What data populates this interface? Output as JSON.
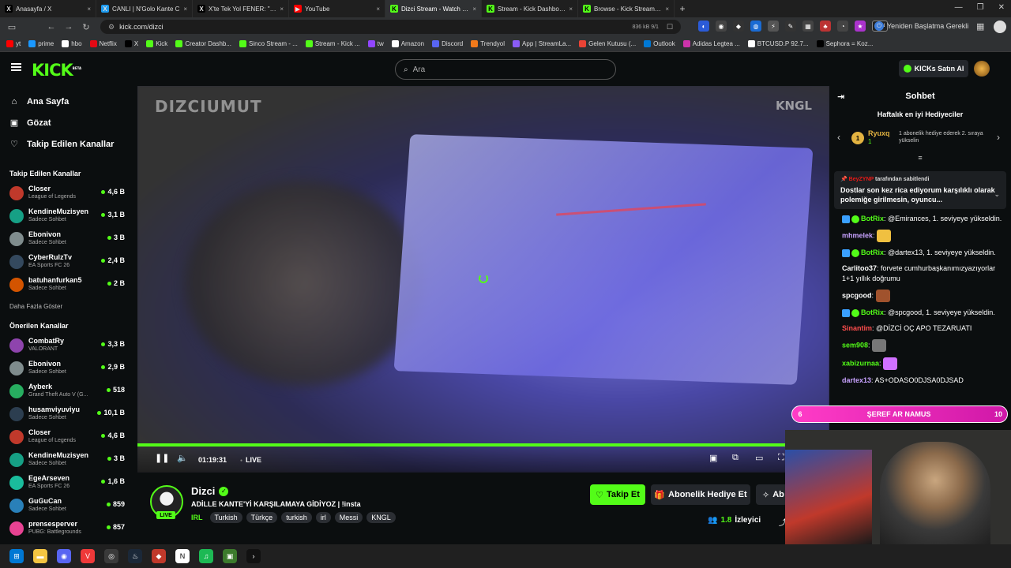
{
  "tabs": [
    {
      "label": "Anasayfa / X",
      "color": "#000000",
      "glyph": "X"
    },
    {
      "label": "CANLI | N'Golo Kante C",
      "color": "#1d9bf0",
      "glyph": "X"
    },
    {
      "label": "X'te Tek Yol FENER: \"Binlerce",
      "color": "#000000",
      "glyph": "X"
    },
    {
      "label": "YouTube",
      "color": "#ff0000",
      "glyph": "▶"
    },
    {
      "label": "Dizci Stream - Watch Live o",
      "color": "#53fc18",
      "glyph": "K"
    },
    {
      "label": "Stream - Kick Dashboard",
      "color": "#53fc18",
      "glyph": "K"
    },
    {
      "label": "Browse - Kick Streaming",
      "color": "#53fc18",
      "glyph": "K"
    }
  ],
  "browser": {
    "url": "kick.com/dizci",
    "meta": "836 kB  9/1",
    "restart_label": "Yeniden Başlatma Gerekli",
    "vpn": "VPN"
  },
  "bookmarks": [
    {
      "label": "yt",
      "color": "#ff0000"
    },
    {
      "label": "prime",
      "color": "#1a98ff"
    },
    {
      "label": "hbo",
      "color": "#ffffff"
    },
    {
      "label": "Netflix",
      "color": "#e50914"
    },
    {
      "label": "X",
      "color": "#000000"
    },
    {
      "label": "Kick",
      "color": "#53fc18"
    },
    {
      "label": "Creator Dashb...",
      "color": "#53fc18"
    },
    {
      "label": "Sinco Stream - ...",
      "color": "#53fc18"
    },
    {
      "label": "Stream - Kick ...",
      "color": "#53fc18"
    },
    {
      "label": "tw",
      "color": "#9146ff"
    },
    {
      "label": "Amazon",
      "color": "#ffffff"
    },
    {
      "label": "Discord",
      "color": "#5865f2"
    },
    {
      "label": "Trendyol",
      "color": "#f27a1a"
    },
    {
      "label": "App | StreamLa...",
      "color": "#8a5cf6"
    },
    {
      "label": "Gelen Kutusu (...",
      "color": "#ea4335"
    },
    {
      "label": "Outlook",
      "color": "#0078d4"
    },
    {
      "label": "Adidas Legtea ...",
      "color": "#cc33aa"
    },
    {
      "label": "BTCUSD.P 92.7...",
      "color": "#ffffff"
    },
    {
      "label": "Sephora = Koz...",
      "color": "#000000"
    }
  ],
  "header": {
    "logo": "KICK",
    "logo_beta": "BETA",
    "search_placeholder": "Ara",
    "buy_kicks": "KICKs Satın Al"
  },
  "sidebar": {
    "nav": [
      {
        "label": "Ana Sayfa",
        "icon": "home-icon"
      },
      {
        "label": "Gözat",
        "icon": "browse-icon"
      },
      {
        "label": "Takip Edilen Kanallar",
        "icon": "heart-icon"
      }
    ],
    "following_title": "Takip Edilen Kanallar",
    "following": [
      {
        "name": "Closer",
        "game": "League of Legends",
        "viewers": "4,6 B",
        "color": "#c0392b"
      },
      {
        "name": "KendineMuzisyen",
        "game": "Sadece Sohbet",
        "viewers": "3,1 B",
        "color": "#16a085"
      },
      {
        "name": "Ebonivon",
        "game": "Sadece Sohbet",
        "viewers": "3 B",
        "color": "#7f8c8d"
      },
      {
        "name": "CyberRulzTv",
        "game": "EA Sports FC 26",
        "viewers": "2,4 B",
        "color": "#34495e"
      },
      {
        "name": "batuhanfurkan5",
        "game": "Sadece Sohbet",
        "viewers": "2 B",
        "color": "#d35400"
      }
    ],
    "show_more": "Daha Fazla Göster",
    "recommended_title": "Önerilen Kanallar",
    "recommended": [
      {
        "name": "CombatRy",
        "game": "VALORANT",
        "viewers": "3,3 B",
        "color": "#8e44ad"
      },
      {
        "name": "Ebonivon",
        "game": "Sadece Sohbet",
        "viewers": "2,9 B",
        "color": "#7f8c8d"
      },
      {
        "name": "Ayberk",
        "game": "Grand Theft Auto V (G...",
        "viewers": "518",
        "color": "#27ae60"
      },
      {
        "name": "husamviyuviyu",
        "game": "Sadece Sohbet",
        "viewers": "10,1 B",
        "color": "#2c3e50"
      },
      {
        "name": "Closer",
        "game": "League of Legends",
        "viewers": "4,6 B",
        "color": "#c0392b"
      },
      {
        "name": "KendineMuzisyen",
        "game": "Sadece Sohbet",
        "viewers": "3 B",
        "color": "#16a085"
      },
      {
        "name": "EgeArseven",
        "game": "EA Sports FC 26",
        "viewers": "1,6 B",
        "color": "#1abc9c"
      },
      {
        "name": "GuGuCan",
        "game": "Sadece Sohbet",
        "viewers": "859",
        "color": "#2980b9"
      },
      {
        "name": "prensesperver",
        "game": "PUBG: Battlegrounds",
        "viewers": "857",
        "color": "#e84393"
      }
    ]
  },
  "video": {
    "watermark": "DIZCIUMUT",
    "watermark2": "KNGL",
    "time": "01:19:31",
    "live": "LIVE"
  },
  "stream": {
    "channel": "Dizci",
    "live_badge": "LIVE",
    "title": "ADİLLE KANTE'Yİ KARŞILAMAYA GİDİYOZ | !insta",
    "category": "IRL",
    "tags": [
      "Turkish",
      "Türkçe",
      "turkish",
      "irl",
      "Messi",
      "KNGL"
    ],
    "follow_label": "Takip Et",
    "gift_label": "Abonelik Hediye Et",
    "sub_label": "Ab",
    "viewers": "1.8",
    "viewers_label": "İzleyici"
  },
  "chat": {
    "title": "Sohbet",
    "gifters_title": "Haftalık en iyi Hediyeciler",
    "top_gifter": {
      "rank": "1",
      "name": "Ryuxq",
      "count": "1",
      "message": "1 abonelik hediye ederek 2. sıraya yükselin"
    },
    "pinned_by": "tarafından sabitlendi",
    "pinned_by_user": "BeyZYNP",
    "pinned_text": "Dostlar son kez rica ediyorum karşılıklı olarak polemiğe girilmesin, oyuncu...",
    "messages": [
      {
        "user": "BotRix",
        "color": "#53fc18",
        "text": "@Emirances, 1. seviyeye yükseldin.",
        "badges": true
      },
      {
        "user": "mhmelek",
        "color": "#c8a2ff",
        "text": "",
        "emote": "#f0c040",
        "badges": false
      },
      {
        "user": "BotRix",
        "color": "#53fc18",
        "text": "@dartex13, 1. seviyeye yükseldin.",
        "badges": true
      },
      {
        "user": "Carlitoo37",
        "color": "#ffffff",
        "text": "forvete cumhurbaşkanımızyazıyorlar 1+1 yıllık doğrumu",
        "badges": false
      },
      {
        "user": "spcgood",
        "color": "#ffffff",
        "text": "",
        "emote": "#a0522d",
        "badges": false
      },
      {
        "user": "BotRix",
        "color": "#53fc18",
        "text": "@spcgood, 1. seviyeye yükseldin.",
        "badges": true
      },
      {
        "user": "Sinantim",
        "color": "#ff4d4d",
        "text": "@DİZCİ OÇ APO TEZARUATI",
        "badges": false
      },
      {
        "user": "sem908",
        "color": "#53fc18",
        "text": "",
        "emote": "#777777",
        "badges": false
      },
      {
        "user": "xabizurnaa",
        "color": "#53fc18",
        "text": "",
        "emote": "#d070ff",
        "badges": false
      },
      {
        "user": "dartex13",
        "color": "#c8a2ff",
        "text": "AS+ODASO0DJSA0DJSAD",
        "badges": false
      }
    ],
    "hype": {
      "left": "6",
      "label": "ŞEREF AR NAMUS",
      "right": "10"
    }
  },
  "taskbar": [
    {
      "name": "windows-start-icon",
      "color": "#0078d4",
      "glyph": "⊞"
    },
    {
      "name": "file-explorer-icon",
      "color": "#f4c542",
      "glyph": "▬"
    },
    {
      "name": "discord-icon",
      "color": "#5865f2",
      "glyph": "◉"
    },
    {
      "name": "vivaldi-icon",
      "color": "#ef3939",
      "glyph": "V"
    },
    {
      "name": "obs-icon",
      "color": "#3a3a3a",
      "glyph": "◎"
    },
    {
      "name": "steam-icon",
      "color": "#1b2838",
      "glyph": "♨"
    },
    {
      "name": "app-red-icon",
      "color": "#c0392b",
      "glyph": "◆"
    },
    {
      "name": "notion-icon",
      "color": "#ffffff",
      "glyph": "N"
    },
    {
      "name": "spotify-icon",
      "color": "#1db954",
      "glyph": "♫"
    },
    {
      "name": "app-green-icon",
      "color": "#3c7a2c",
      "glyph": "▣"
    },
    {
      "name": "terminal-icon",
      "color": "#111111",
      "glyph": "›"
    }
  ]
}
